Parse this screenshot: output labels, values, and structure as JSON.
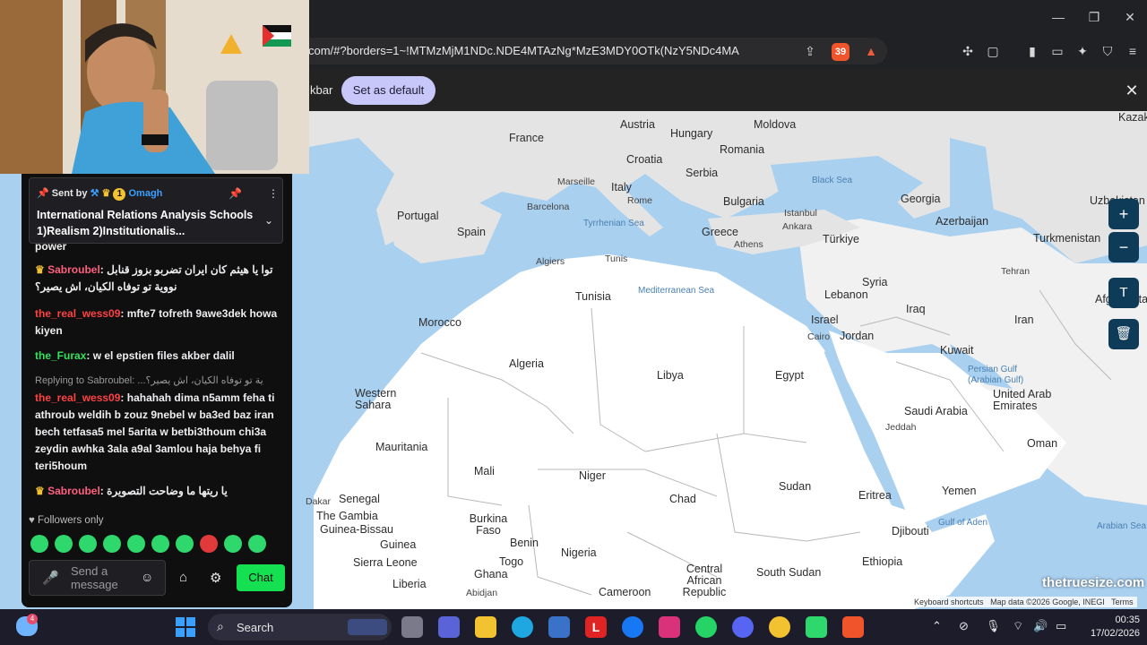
{
  "browser": {
    "url": "com/#?borders=1~!MTMzMjM1NDc.NDE4MTAzNg*MzE3MDY0OTk(NzY5NDc4MA",
    "brave_shield_count": "39",
    "banner_text": "kbar",
    "set_default_label": "Set as default"
  },
  "map": {
    "countries": [
      "France",
      "Austria",
      "Hungary",
      "Moldova",
      "Romania",
      "Croatia",
      "Serbia",
      "Italy",
      "Bulgaria",
      "Portugal",
      "Spain",
      "Greece",
      "Türkiye",
      "Georgia",
      "Azerbaijan",
      "Turkmenistan",
      "Uzbekistan",
      "Kazakhstan",
      "Morocco",
      "Algeria",
      "Tunisia",
      "Libya",
      "Egypt",
      "Syria",
      "Lebanon",
      "Israel",
      "Jordan",
      "Iraq",
      "Iran",
      "Kuwait",
      "Saudi Arabia",
      "United Arab Emirates",
      "Oman",
      "Yemen",
      "Western Sahara",
      "Mauritania",
      "Mali",
      "Niger",
      "Chad",
      "Sudan",
      "Eritrea",
      "Djibouti",
      "Ethiopia",
      "South Sudan",
      "Central African Republic",
      "Cameroon",
      "Nigeria",
      "Benin",
      "Togo",
      "Ghana",
      "Burkina Faso",
      "Guinea",
      "Sierra Leone",
      "Liberia",
      "Senegal",
      "The Gambia",
      "Guinea-Bissau",
      "Afghanistan"
    ],
    "cities": [
      "Marseille",
      "Barcelona",
      "Rome",
      "Istanbul",
      "Ankara",
      "Athens",
      "Algiers",
      "Tunis",
      "Cairo",
      "Tehran",
      "Jeddah",
      "Dakar",
      "Abidjan"
    ],
    "seas": [
      "Black Sea",
      "Tyrrhenian Sea",
      "Mediterranean Sea",
      "Persian Gulf (Arabian Gulf)",
      "Gulf of Aden",
      "Arabian Sea"
    ],
    "brand": "thetruesize.com",
    "attribution": [
      "Keyboard shortcuts",
      "Map data ©2026 Google, INEGI",
      "Terms"
    ],
    "zoom_in_label": "+",
    "zoom_out_label": "−"
  },
  "chat": {
    "pinned_sender_prefix": "Sent by",
    "pinned_sender": "Omagh",
    "pinned_badge_count": "1",
    "pinned_title": "International Relations Analysis Schools 1)Realism 2)Institutionalis...",
    "partial_text": "power",
    "messages": [
      {
        "user": "Sabroubel",
        "text": "توا يا هيثم كان ايران تضربو بزوز قنابل نووية تو توفاه الكيان، اش يصير؟"
      },
      {
        "user": "the_real_wess09",
        "text": "mfte7 tofreth 9awe3dek howa kiyen"
      },
      {
        "user": "the_Furax",
        "text": "w el epstien files akber dalil"
      },
      {
        "reply": "Replying to Sabroubel: ...ية تو توفاه الكيان، اش يصير؟",
        "user": "the_real_wess09",
        "text": "hahahah dima n5amm feha ti athroub weldih b zouz 9nebel w ba3ed baz iran bech tetfasa5 mel 5arita w betbi3thoum chi3a zeydin awhka 3ala a9al 3amlou haja behya fi teri5houm"
      },
      {
        "user": "Sabroubel",
        "text": "يا ريتها ما وضاحت التصويرة"
      }
    ],
    "followers_only": "Followers only",
    "input_placeholder": "Send a message",
    "chat_button": "Chat"
  },
  "taskbar": {
    "search_label": "Search",
    "notification_count": "4",
    "time": "00:35",
    "date": "17/02/2026"
  },
  "colors": {
    "accent_chat": "#15e051",
    "map_button": "#0e3b57",
    "set_default": "#c8c7f9"
  }
}
